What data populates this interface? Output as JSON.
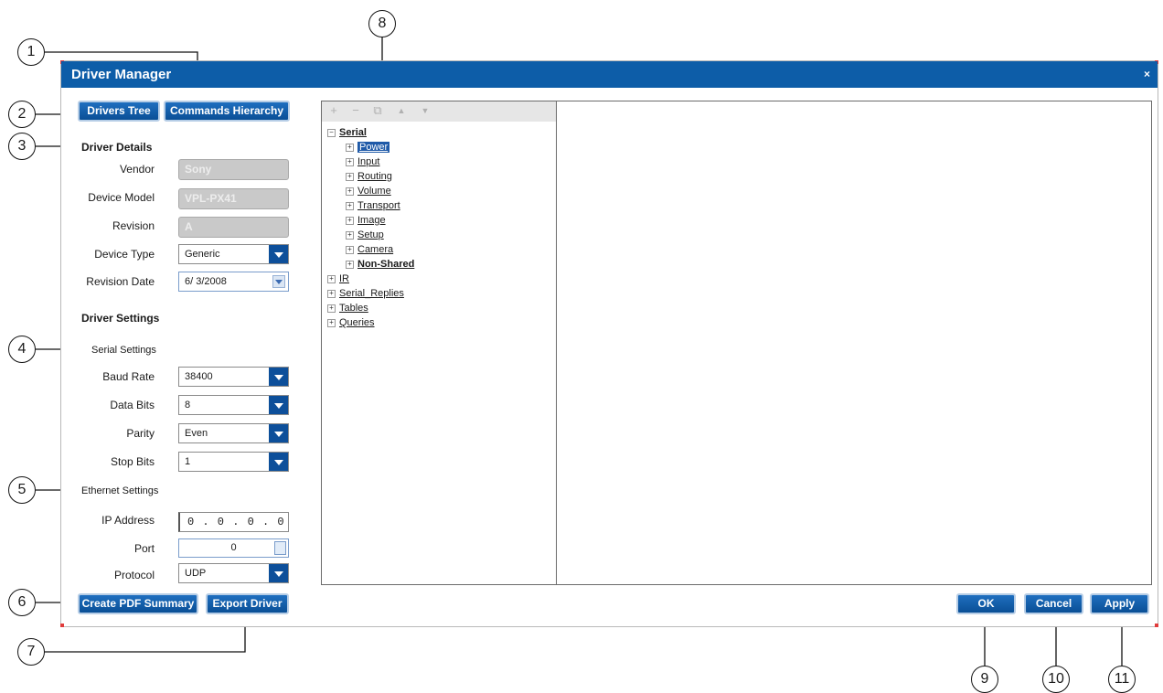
{
  "window": {
    "title": "Driver Manager",
    "close_label": "×"
  },
  "top_buttons": {
    "drivers_tree": "Drivers Tree",
    "commands_hierarchy": "Commands Hierarchy"
  },
  "driver_details": {
    "heading": "Driver Details",
    "vendor_label": "Vendor",
    "vendor_value": "Sony",
    "model_label": "Device Model",
    "model_value": "VPL-PX41",
    "revision_label": "Revision",
    "revision_value": "A",
    "type_label": "Device Type",
    "type_value": "Generic",
    "date_label": "Revision Date",
    "date_value": "6/ 3/2008"
  },
  "driver_settings": {
    "heading": "Driver Settings",
    "serial_heading": "Serial Settings",
    "baud_label": "Baud Rate",
    "baud_value": "38400",
    "data_bits_label": "Data Bits",
    "data_bits_value": "8",
    "parity_label": "Parity",
    "parity_value": "Even",
    "stop_bits_label": "Stop Bits",
    "stop_bits_value": "1",
    "ethernet_heading": "Ethernet Settings",
    "ip_label": "IP Address",
    "ip_value": "0 . 0 . 0 . 0",
    "port_label": "Port",
    "port_value": "0",
    "protocol_label": "Protocol",
    "protocol_value": "UDP"
  },
  "bottom_buttons": {
    "pdf_summary": "Create PDF Summary",
    "export_driver": "Export Driver",
    "ok": "OK",
    "cancel": "Cancel",
    "apply": "Apply"
  },
  "toolbar_icons": [
    {
      "name": "add-icon",
      "glyph": "+"
    },
    {
      "name": "remove-icon",
      "glyph": "−"
    },
    {
      "name": "copy-icon",
      "glyph": "⧉"
    },
    {
      "name": "move-up-icon",
      "glyph": "▲"
    },
    {
      "name": "move-down-icon",
      "glyph": "▼"
    }
  ],
  "tree": {
    "serial": "Serial",
    "serial_children": [
      "Power",
      "Input",
      "Routing",
      "Volume",
      "Transport",
      "Image",
      "Setup",
      "Camera",
      "Non-Shared"
    ],
    "top_nodes": [
      "IR",
      "Serial_Replies",
      "Tables",
      "Queries"
    ]
  },
  "callouts": [
    "1",
    "2",
    "3",
    "4",
    "5",
    "6",
    "7",
    "8",
    "9",
    "10",
    "11"
  ],
  "colors": {
    "titlebar": "#0d5da8",
    "button": "#0a4f96",
    "selection": "#1f5aa8"
  }
}
